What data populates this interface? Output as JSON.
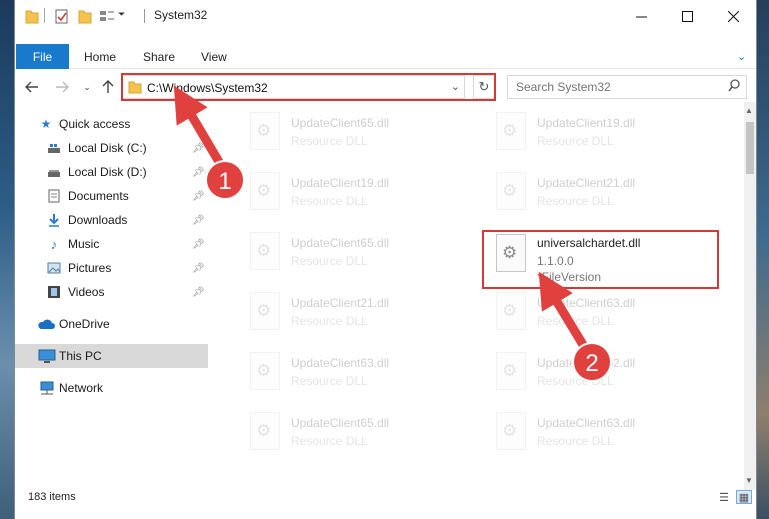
{
  "window": {
    "title": "System32"
  },
  "ribbon": {
    "tabs": [
      "File",
      "Home",
      "Share",
      "View"
    ]
  },
  "address": {
    "path": "C:\\Windows\\System32",
    "search_placeholder": "Search System32"
  },
  "sidebar": {
    "items": [
      {
        "label": "Quick access",
        "icon": "star-icon"
      },
      {
        "label": "Local Disk (C:)",
        "icon": "drive-icon",
        "pinned": true
      },
      {
        "label": "Local Disk (D:)",
        "icon": "drive-icon",
        "pinned": true
      },
      {
        "label": "Documents",
        "icon": "documents-icon",
        "pinned": true
      },
      {
        "label": "Downloads",
        "icon": "download-icon",
        "pinned": true
      },
      {
        "label": "Music",
        "icon": "music-icon",
        "pinned": true
      },
      {
        "label": "Pictures",
        "icon": "pictures-icon",
        "pinned": true
      },
      {
        "label": "Videos",
        "icon": "videos-icon",
        "pinned": true
      },
      {
        "label": "OneDrive",
        "icon": "cloud-icon"
      },
      {
        "label": "This PC",
        "icon": "computer-icon",
        "selected": true
      },
      {
        "label": "Network",
        "icon": "network-icon"
      }
    ]
  },
  "files": {
    "left": [
      {
        "name": "UpdateClient65.dll",
        "type": "Resource DLL"
      },
      {
        "name": "UpdateClient19.dll",
        "type": "Resource DLL"
      },
      {
        "name": "UpdateClient65.dll",
        "type": "Resource DLL"
      },
      {
        "name": "UpdateClient21.dll",
        "type": "Resource DLL"
      },
      {
        "name": "UpdateClient63.dll",
        "type": "Resource DLL"
      },
      {
        "name": "UpdateClient65.dll",
        "type": "Resource DLL"
      }
    ],
    "right": [
      {
        "name": "UpdateClient19.dll",
        "type": "Resource DLL"
      },
      {
        "name": "UpdateClient21.dll",
        "type": "Resource DLL"
      },
      {
        "name": "universalchardet.dll",
        "version": "1.1.0.0",
        "desc": "*FileVersion",
        "selected": true
      },
      {
        "name": "UpdateClient63.dll",
        "type": "Resource DLL"
      },
      {
        "name": "UpdateClient62.dll",
        "type": "Resource DLL"
      },
      {
        "name": "UpdateClient63.dll",
        "type": "Resource DLL"
      }
    ]
  },
  "status": {
    "count": "183 items"
  },
  "annotations": {
    "marker1": "1",
    "marker2": "2",
    "color": "#e0413e"
  },
  "colors": {
    "accent": "#1979ca",
    "highlight": "#d23a3a"
  }
}
